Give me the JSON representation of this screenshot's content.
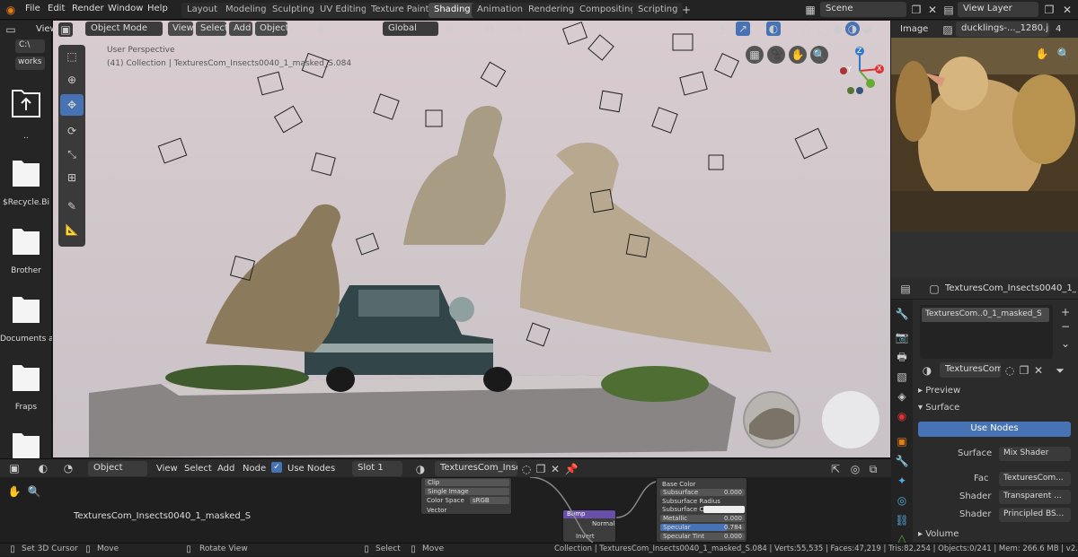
{
  "menu": {
    "items": [
      "File",
      "Edit",
      "Render",
      "Window",
      "Help"
    ],
    "workspaces": [
      "Layout",
      "Modeling",
      "Sculpting",
      "UV Editing",
      "Texture Paint",
      "Shading",
      "Animation",
      "Rendering",
      "Compositing",
      "Scripting"
    ],
    "active_workspace": "Shading",
    "scene": "Scene",
    "view_layer": "View Layer"
  },
  "filebrowser": {
    "view_label": "View",
    "path_top": "C:\\",
    "path_sub": "works",
    "parent": "..",
    "folders": [
      "$Recycle.Bi",
      "Brother",
      "Documents a",
      "Fraps"
    ]
  },
  "viewport": {
    "mode": "Object Mode",
    "menus": [
      "View",
      "Select",
      "Add",
      "Object"
    ],
    "orientation": "Global",
    "perspective_label": "User Perspective",
    "collection_label": "(41) Collection | TexturesCom_Insects0040_1_masked_S.084",
    "axis_x": "X",
    "axis_y": "Y",
    "axis_z": "Z"
  },
  "image_editor": {
    "label": "Image",
    "filename": "ducklings-..._1280.jpg",
    "users": "4"
  },
  "properties": {
    "object_name": "TexturesCom_Insects0040_1_maske",
    "material_slot": "TexturesCom..0_1_masked_S",
    "material_name": "TexturesCom...",
    "preview": "Preview",
    "surface_section": "Surface",
    "use_nodes": "Use Nodes",
    "surface_label": "Surface",
    "surface_value": "Mix Shader",
    "fac_label": "Fac",
    "fac_value": "TexturesCom...",
    "shader1_label": "Shader",
    "shader1_value": "Transparent ...",
    "shader2_label": "Shader",
    "shader2_value": "Principled BS...",
    "volume": "Volume"
  },
  "node_editor": {
    "object_mode": "Object",
    "menus": [
      "View",
      "Select",
      "Add",
      "Node"
    ],
    "use_nodes": "Use Nodes",
    "slot": "Slot 1",
    "material": "TexturesCom_Insec...",
    "material_caption": "TexturesCom_Insects0040_1_masked_S",
    "image_node": {
      "clip": "Clip",
      "projection": "Single Image",
      "colorspace_label": "Color Space",
      "colorspace": "sRGB",
      "vector": "Vector"
    },
    "bump_node": {
      "title": "Bump",
      "normal": "Normal",
      "invert": "Invert"
    },
    "bsdf_node": {
      "rows": [
        {
          "label": "Base Color",
          "value": ""
        },
        {
          "label": "Subsurface",
          "value": "0.000"
        },
        {
          "label": "Subsurface Radius",
          "value": ""
        },
        {
          "label": "Subsurface Color",
          "value": ""
        },
        {
          "label": "Metallic",
          "value": "0.000"
        },
        {
          "label": "Specular",
          "value": "0.784"
        },
        {
          "label": "Specular Tint",
          "value": "0.000"
        }
      ]
    }
  },
  "statusbar": {
    "left1": "Set 3D Cursor",
    "left2": "Move",
    "left3": "Rotate View",
    "mid1": "Select",
    "mid2": "Move",
    "stats": "Collection | TexturesCom_Insects0040_1_masked_S.084 | Verts:55,535 | Faces:47,219 | Tris:82,254 | Objects:0/241 | Mem: 266.6 MB | v2.80.75"
  },
  "colors": {
    "accent": "#4772b3",
    "header_bg": "#232323",
    "panel_bg": "#2b2b2b"
  }
}
